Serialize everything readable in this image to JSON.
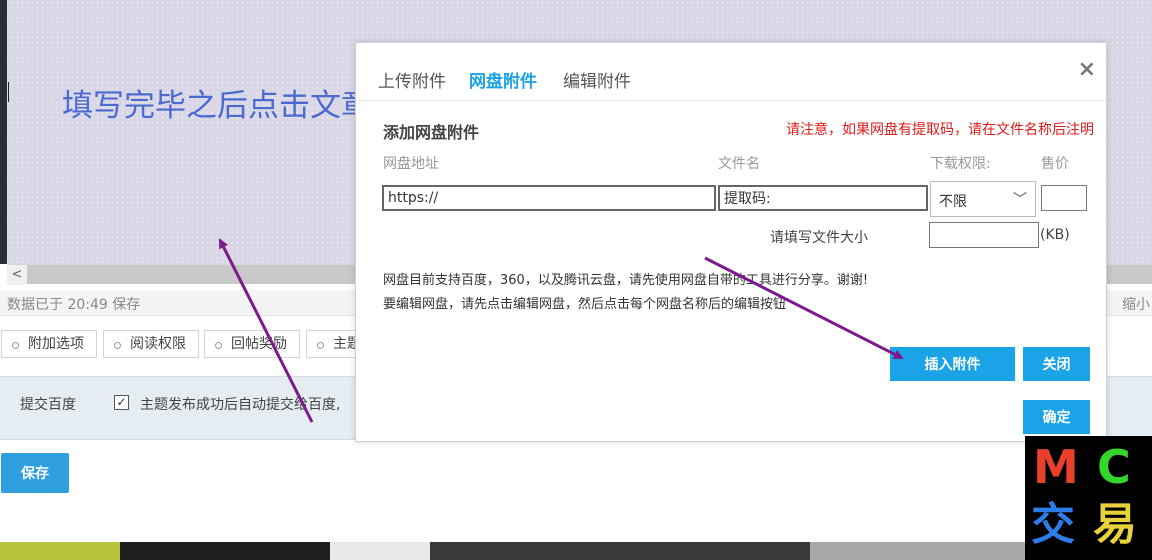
{
  "editor": {
    "annotation": "填写完毕之后点击文章空白处然后点击插入附件",
    "status_text": "数据已于 20:49 保存",
    "status_right": "缩小"
  },
  "option_tabs": [
    {
      "label": "附加选项"
    },
    {
      "label": "阅读权限"
    },
    {
      "label": "回帖奖励"
    },
    {
      "label": "主题"
    }
  ],
  "baidu": {
    "label": "提交百度",
    "checkbox_label": "主题发布成功后自动提交给百度,"
  },
  "save_label": "保存",
  "modal": {
    "tabs": [
      "上传附件",
      "网盘附件",
      "编辑附件"
    ],
    "active_tab": "网盘附件",
    "close_symbol": "×",
    "section_title": "添加网盘附件",
    "notice": "请注意，如果网盘有提取码，请在文件名称后注明",
    "col_url": "网盘地址",
    "col_filename": "文件名",
    "col_permission": "下载权限:",
    "col_price": "售价",
    "url_value": "https://",
    "filename_value": "提取码:",
    "permission_selected": "不限",
    "price_value": "",
    "size_label": "请填写文件大小",
    "size_value": "",
    "size_unit": "(KB)",
    "info_line1": "网盘目前支持百度，360，以及腾讯云盘，请先使用网盘自带的工具进行分享。谢谢!",
    "info_line2": "要编辑网盘，请先点击编辑网盘，然后点击每个网盘名称后的编辑按钮",
    "insert_label": "插入附件",
    "close_label": "关闭",
    "confirm_label": "确定"
  },
  "logo": {
    "l1": "M",
    "l2": "C",
    "l3": "交",
    "l4": "易"
  },
  "colors": {
    "accent": "#1aa3e6",
    "notice": "#e01a1a",
    "annotation": "#4a6ad1",
    "arrow": "#7a1c8c"
  }
}
